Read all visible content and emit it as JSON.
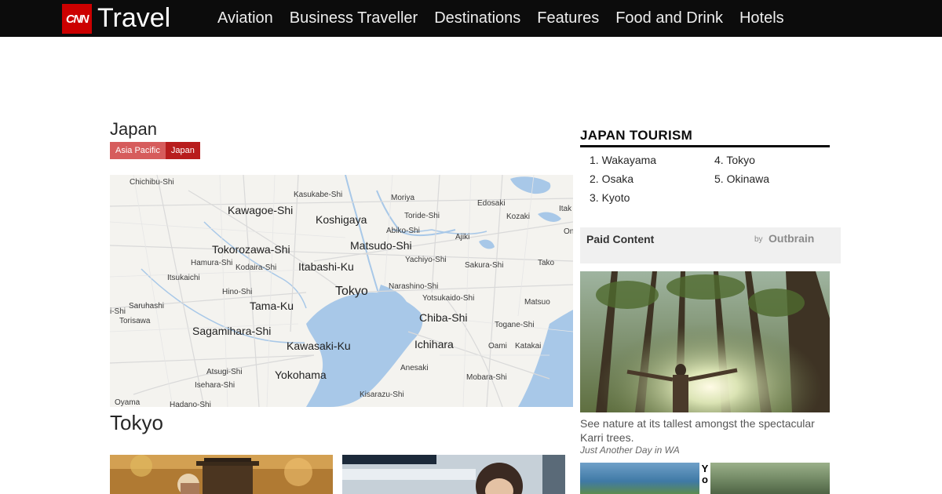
{
  "header": {
    "logo_text": "CNN",
    "section_title": "Travel",
    "nav": [
      "Aviation",
      "Business Traveller",
      "Destinations",
      "Features",
      "Food and Drink",
      "Hotels"
    ]
  },
  "page": {
    "country": "Japan",
    "breadcrumbs": [
      "Asia Pacific",
      "Japan"
    ],
    "city_heading": "Tokyo"
  },
  "map": {
    "labels": [
      {
        "text": "Chichibu-Shi",
        "size": "s"
      },
      {
        "text": "Kasukabe-Shi",
        "size": "s"
      },
      {
        "text": "Moriya",
        "size": "s"
      },
      {
        "text": "Edosaki",
        "size": "s"
      },
      {
        "text": "Itak",
        "size": "s"
      },
      {
        "text": "Kawagoe-Shi",
        "size": "m"
      },
      {
        "text": "Koshigaya",
        "size": "m"
      },
      {
        "text": "Toride-Shi",
        "size": "s"
      },
      {
        "text": "Kozaki",
        "size": "s"
      },
      {
        "text": "Abiko-Shi",
        "size": "s"
      },
      {
        "text": "Ajiki",
        "size": "s"
      },
      {
        "text": "On",
        "size": "s"
      },
      {
        "text": "Tokorozawa-Shi",
        "size": "m"
      },
      {
        "text": "Matsudo-Shi",
        "size": "m"
      },
      {
        "text": "Hamura-Shi",
        "size": "s"
      },
      {
        "text": "Kodaira-Shi",
        "size": "s"
      },
      {
        "text": "Itabashi-Ku",
        "size": "m"
      },
      {
        "text": "Yachiyo-Shi",
        "size": "s"
      },
      {
        "text": "Sakura-Shi",
        "size": "s"
      },
      {
        "text": "Tako",
        "size": "s"
      },
      {
        "text": "Itsukaichi",
        "size": "s"
      },
      {
        "text": "Hino-Shi",
        "size": "s"
      },
      {
        "text": "Tokyo",
        "size": "l"
      },
      {
        "text": "Narashino-Shi",
        "size": "s"
      },
      {
        "text": "Yotsukaido-Shi",
        "size": "s"
      },
      {
        "text": "Saruhashi",
        "size": "s"
      },
      {
        "text": "Tama-Ku",
        "size": "m"
      },
      {
        "text": "Matsuo",
        "size": "s"
      },
      {
        "text": "i-Shi",
        "size": "s"
      },
      {
        "text": "Chiba-Shi",
        "size": "m"
      },
      {
        "text": "Torisawa",
        "size": "s"
      },
      {
        "text": "Togane-Shi",
        "size": "s"
      },
      {
        "text": "Sagamihara-Shi",
        "size": "m"
      },
      {
        "text": "Kawasaki-Ku",
        "size": "m"
      },
      {
        "text": "Ichihara",
        "size": "m"
      },
      {
        "text": "Oami",
        "size": "s"
      },
      {
        "text": "Katakai",
        "size": "s"
      },
      {
        "text": "Atsugi-Shi",
        "size": "s"
      },
      {
        "text": "Anesaki",
        "size": "s"
      },
      {
        "text": "Yokohama",
        "size": "m"
      },
      {
        "text": "Mobara-Shi",
        "size": "s"
      },
      {
        "text": "Isehara-Shi",
        "size": "s"
      },
      {
        "text": "Kisarazu-Shi",
        "size": "s"
      },
      {
        "text": "Oyama",
        "size": "s"
      },
      {
        "text": "Hadano-Shi",
        "size": "s"
      }
    ]
  },
  "tourism": {
    "title": "JAPAN TOURISM",
    "items": [
      "1. Wakayama",
      "2. Osaka",
      "3. Kyoto",
      "4. Tokyo",
      "5. Okinawa"
    ]
  },
  "paid": {
    "label": "Paid Content",
    "by": "by",
    "brand": "Outbrain"
  },
  "ad": {
    "caption": "See nature at its tallest amongst the spectacular Karri trees.",
    "source": "Just Another Day in WA",
    "second_letters": "Yo"
  },
  "colors": {
    "header_bg": "#0c0c0c",
    "brand_red": "#cc0000",
    "crumb_light": "#d65c5c",
    "crumb_dark": "#b81d1d",
    "water": "#a8c8e8"
  }
}
